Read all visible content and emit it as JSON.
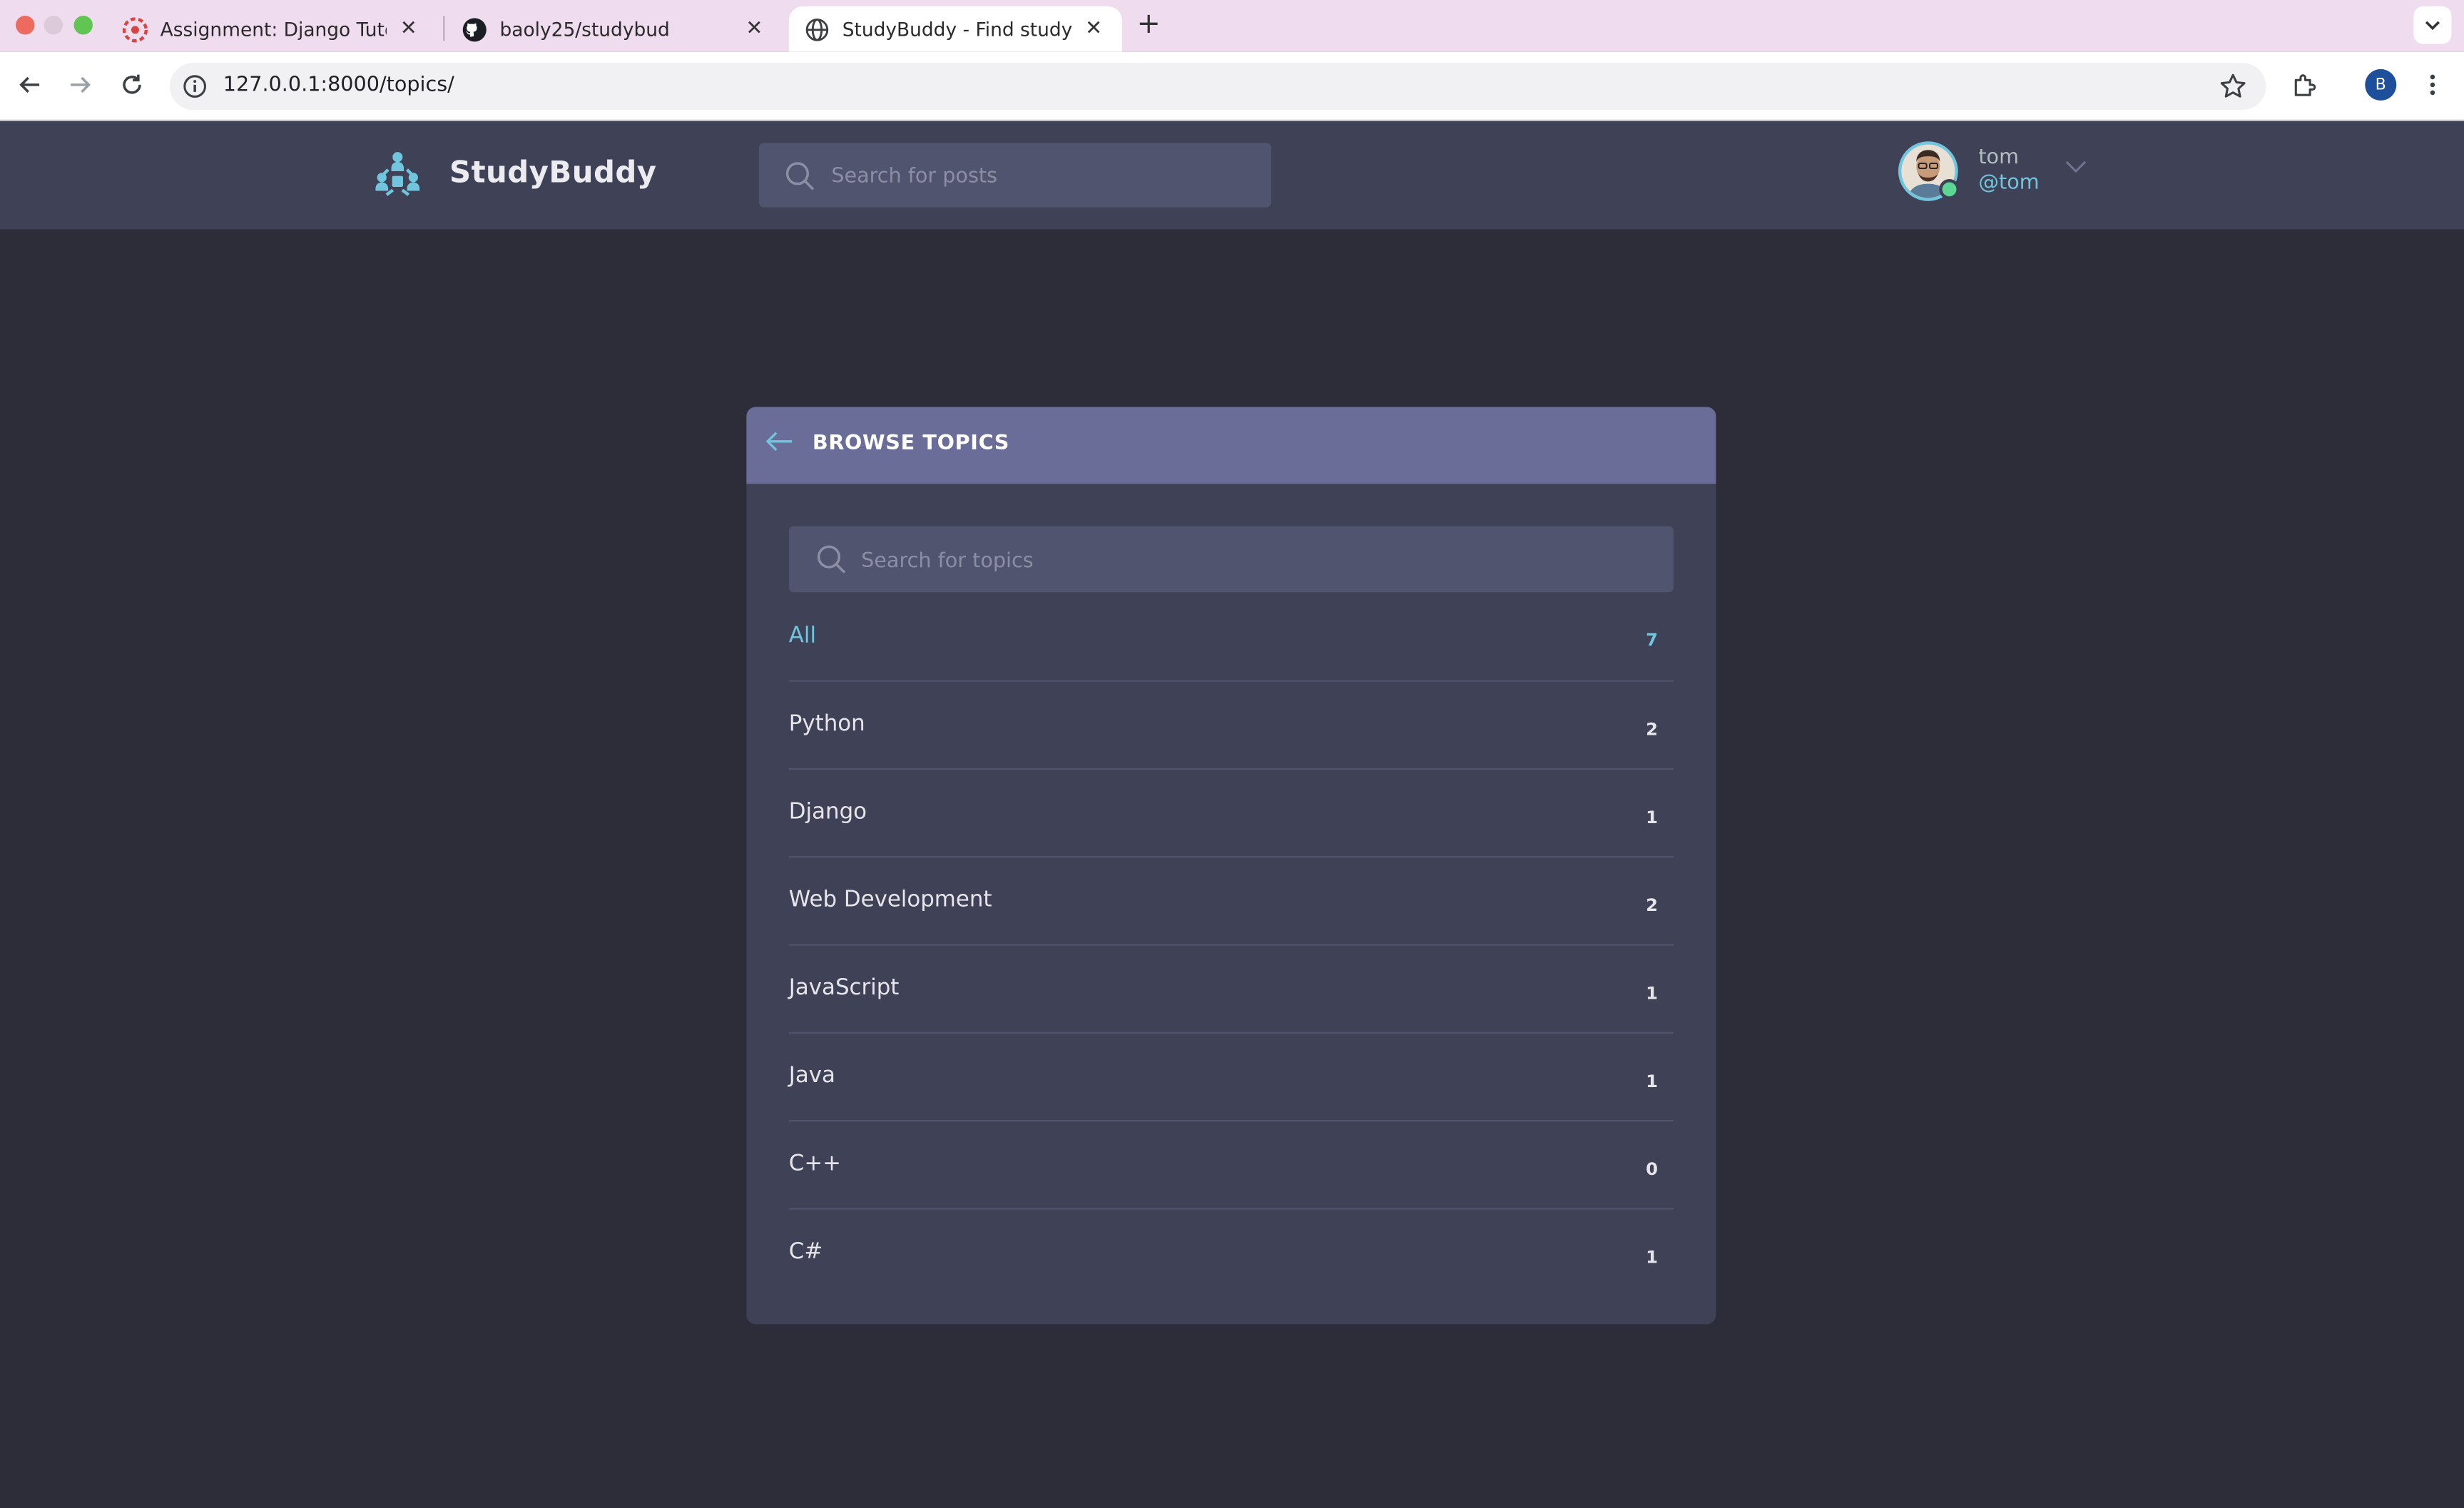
{
  "browser": {
    "tabs": [
      {
        "title": "Assignment: Django Tutorial p",
        "favicon": "ucsd-logo-icon",
        "active": false
      },
      {
        "title": "baoly25/studybud",
        "favicon": "github-icon",
        "active": false
      },
      {
        "title": "StudyBuddy - Find study part",
        "favicon": "globe-icon",
        "active": true
      }
    ],
    "url": "127.0.0.1:8000/topics/",
    "profile_initial": "B"
  },
  "header": {
    "brand": "StudyBuddy",
    "search_placeholder": "Search for posts",
    "user": {
      "name": "tom",
      "handle": "@tom"
    }
  },
  "topics_card": {
    "title": "BROWSE TOPICS",
    "search_placeholder": "Search for topics",
    "topics": [
      {
        "name": "All",
        "count": "7",
        "active": true
      },
      {
        "name": "Python",
        "count": "2"
      },
      {
        "name": "Django",
        "count": "1"
      },
      {
        "name": "Web Development",
        "count": "2"
      },
      {
        "name": "JavaScript",
        "count": "1"
      },
      {
        "name": "Java",
        "count": "1"
      },
      {
        "name": "C++",
        "count": "0"
      },
      {
        "name": "C#",
        "count": "1"
      }
    ]
  },
  "colors": {
    "page_bg": "#2d2d39",
    "header_bg": "#3f4156",
    "card_header_bg": "#696d97",
    "accent": "#71c6dd",
    "online": "#5dd693"
  }
}
